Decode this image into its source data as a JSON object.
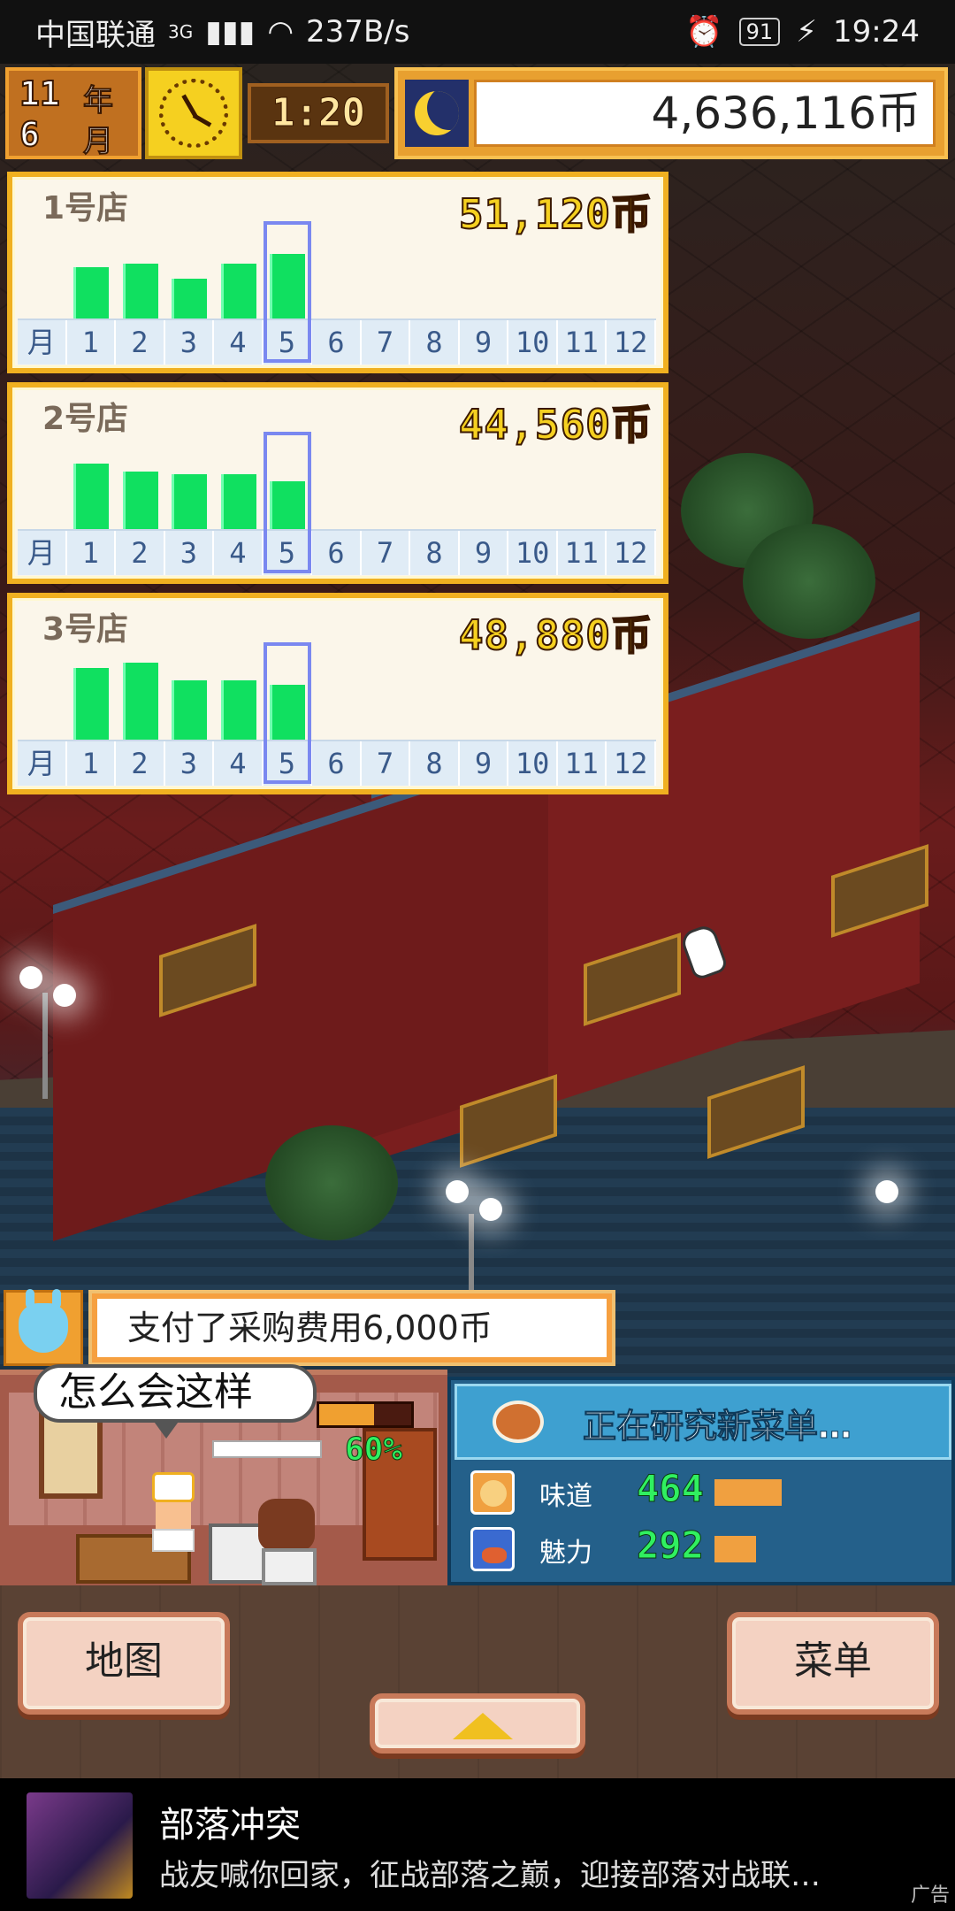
{
  "status_bar": {
    "carrier": "中国联通",
    "network": "3G",
    "speed": "237B/s",
    "battery": "91",
    "time": "19:24"
  },
  "hud": {
    "year": "11",
    "year_label": "年",
    "month": "6",
    "month_label": "月",
    "speed": "1:20",
    "money": "4,636,116币",
    "clock_icon": "clock-icon",
    "night_icon": "moon-icon"
  },
  "shops": [
    {
      "name": "1号店",
      "total": "51,120币",
      "bars": [
        0.52,
        0.55,
        0.4,
        0.55,
        0.65
      ],
      "highlight_month": 5
    },
    {
      "name": "2号店",
      "total": "44,560币",
      "bars": [
        0.66,
        0.58,
        0.55,
        0.55,
        0.48
      ],
      "highlight_month": 5
    },
    {
      "name": "3号店",
      "total": "48,880币",
      "bars": [
        0.72,
        0.78,
        0.6,
        0.6,
        0.55
      ],
      "highlight_month": 5
    }
  ],
  "months": [
    "月",
    "1",
    "2",
    "3",
    "4",
    "5",
    "6",
    "7",
    "8",
    "9",
    "10",
    "11",
    "12"
  ],
  "message": "支付了采购费用6,000币",
  "kitchen": {
    "speech": "怎么会这样",
    "progress_percent": "60%",
    "progress_value": 0.6
  },
  "research": {
    "title": "正在研究新菜单…",
    "taste_label": "味道",
    "taste_value": "464",
    "taste_fill": 0.31,
    "charm_label": "魅力",
    "charm_value": "292",
    "charm_fill": 0.19
  },
  "buttons": {
    "map": "地图",
    "menu": "菜单"
  },
  "ad": {
    "title": "部落冲突",
    "description": "战友喊你回家，征战部落之巅，迎接部落对战联…",
    "tag": "广告"
  },
  "colors": {
    "bar_green": "#10e060",
    "panel_border": "#f0b020",
    "highlight_blue": "#7a88f0",
    "research_blue": "#24608a"
  }
}
